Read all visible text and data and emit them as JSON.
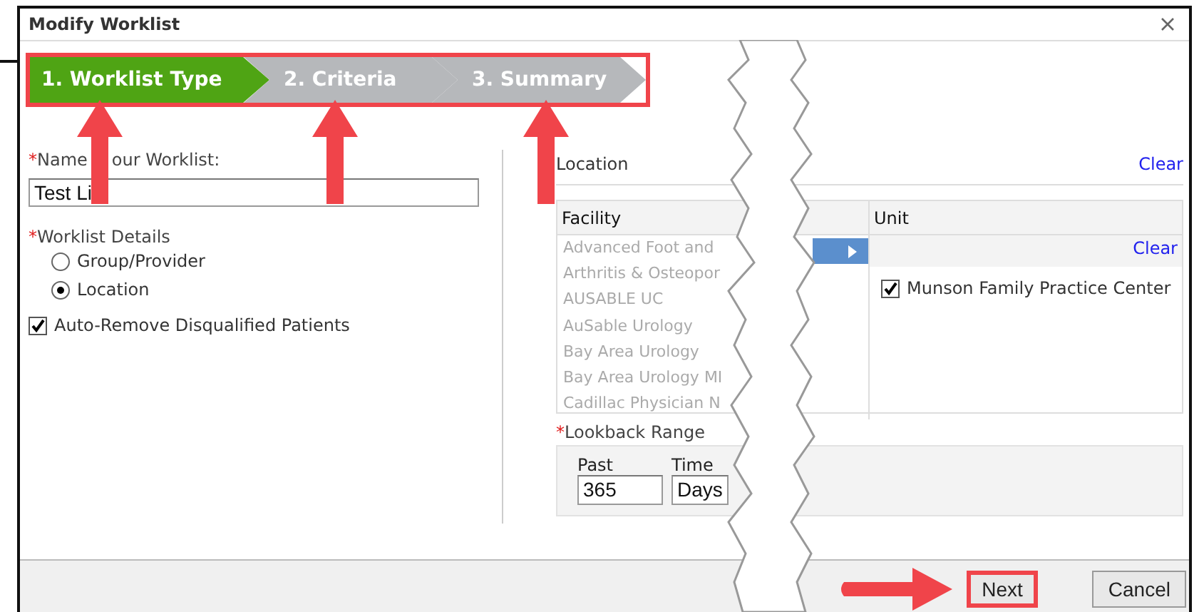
{
  "window": {
    "title": "Modify Worklist"
  },
  "steps": [
    {
      "label": "1. Worklist Type",
      "selected": true
    },
    {
      "label": "2. Criteria",
      "selected": false
    },
    {
      "label": "3. Summary",
      "selected": false
    }
  ],
  "name": {
    "required_mark": "*",
    "label_parts": [
      "Name",
      "our Worklist:"
    ],
    "value": "Test Li"
  },
  "details": {
    "required_mark": "*",
    "label": "Worklist Details",
    "options": [
      {
        "label": "Group/Provider",
        "selected": false
      },
      {
        "label": "Location",
        "selected": true
      }
    ]
  },
  "auto_remove": {
    "label": "Auto-Remove Disqualified Patients",
    "checked": true
  },
  "location": {
    "title": "Location",
    "clear": "Clear",
    "columns": [
      "Facility",
      "Unit"
    ],
    "facilities": [
      "Advanced Foot and",
      "Arthritis & Osteopor",
      "AUSABLE UC",
      "AuSable Urology",
      "Bay Area Urology",
      "Bay Area Urology MI",
      "Cadillac Physician N"
    ],
    "unit_clear": "Clear",
    "units": [
      {
        "label": "Munson Family Practice Center",
        "checked": true
      }
    ]
  },
  "lookback": {
    "required_mark": "*",
    "label": "Lookback Range",
    "past_label": "Past",
    "past_value": "365",
    "unit_label": "Time",
    "unit_value": "Days"
  },
  "buttons": [
    {
      "label": "Next",
      "highlighted": true
    },
    {
      "label": "Cancel",
      "highlighted": false
    }
  ]
}
